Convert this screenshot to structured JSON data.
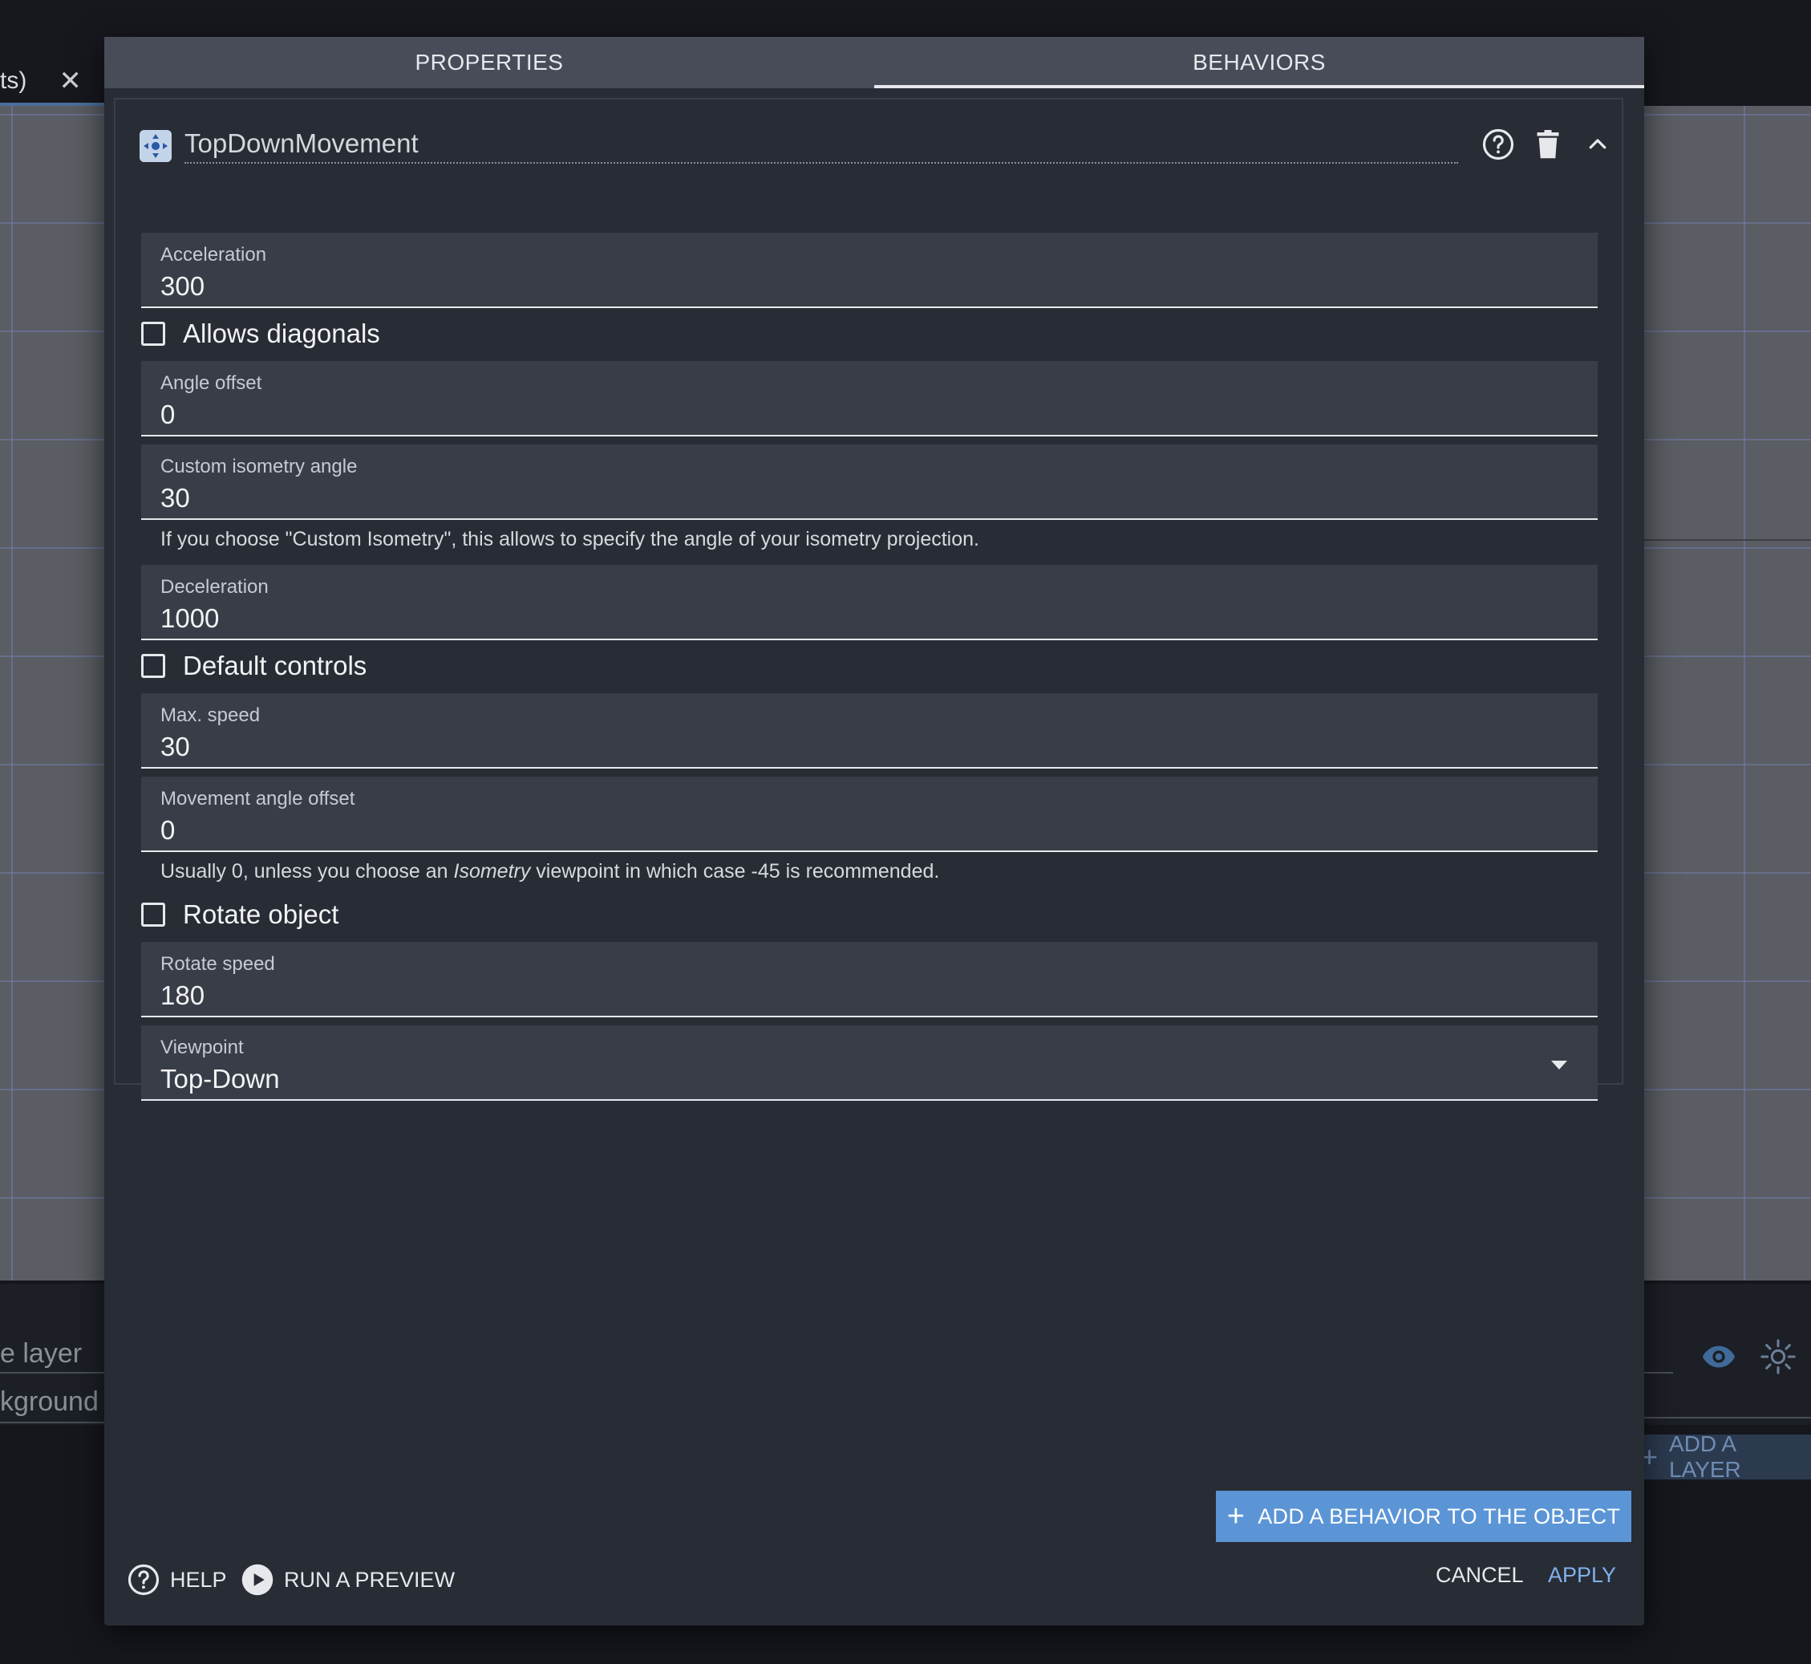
{
  "background": {
    "tab_label": "ts)",
    "tab_close": "✕",
    "layer_row_1": "e layer",
    "layer_row_2": "kground c",
    "add_layer_label": "ADD A LAYER",
    "add_layer_plus": "+"
  },
  "dialog": {
    "tabs": [
      {
        "label": "PROPERTIES",
        "active": false
      },
      {
        "label": "BEHAVIORS",
        "active": true
      }
    ],
    "behavior": {
      "name": "TopDownMovement",
      "icon": "movement-icon"
    },
    "fields": {
      "acceleration": {
        "label": "Acceleration",
        "value": "300"
      },
      "allows_diagonals": {
        "label": "Allows diagonals",
        "checked": false
      },
      "angle_offset": {
        "label": "Angle offset",
        "value": "0"
      },
      "custom_isometry_angle": {
        "label": "Custom isometry angle",
        "value": "30"
      },
      "custom_isometry_help": "If you choose \"Custom Isometry\", this allows to specify the angle of your isometry projection.",
      "deceleration": {
        "label": "Deceleration",
        "value": "1000"
      },
      "default_controls": {
        "label": "Default controls",
        "checked": false
      },
      "max_speed": {
        "label": "Max. speed",
        "value": "30"
      },
      "movement_angle_offset": {
        "label": "Movement angle offset",
        "value": "0"
      },
      "movement_help": {
        "before": "Usually 0, unless you choose an ",
        "emphasis": "Isometry",
        "after": " viewpoint in which case -45 is recommended."
      },
      "rotate_object": {
        "label": "Rotate object",
        "checked": false
      },
      "rotate_speed": {
        "label": "Rotate speed",
        "value": "180"
      },
      "viewpoint": {
        "label": "Viewpoint",
        "value": "Top-Down"
      }
    },
    "add_behavior_label": "ADD A BEHAVIOR TO THE OBJECT",
    "add_behavior_plus": "+",
    "footer": {
      "help": "HELP",
      "preview": "RUN A PREVIEW",
      "cancel": "CANCEL",
      "apply": "APPLY"
    }
  },
  "colors": {
    "accent": "#5b95d6",
    "apply_text": "#7fb1ea",
    "dialog_bg": "#282c35",
    "field_bg": "#393d47",
    "tab_bar": "#474c58"
  }
}
